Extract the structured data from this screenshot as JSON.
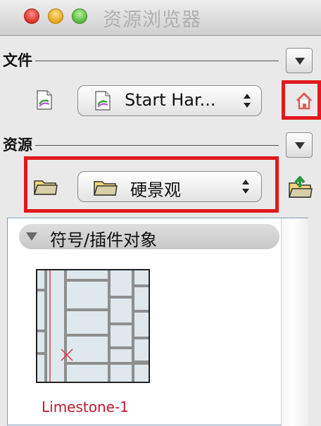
{
  "window": {
    "title": "资源浏览器"
  },
  "file_section": {
    "label": "文件",
    "popup_value": "Start Har...",
    "dropdown_icon": "triangle-down",
    "home_icon": "house-icon"
  },
  "resource_section": {
    "label": "资源",
    "popup_value": "硬景观",
    "dropdown_icon": "triangle-down",
    "import_icon": "folder-up-arrow-icon"
  },
  "content": {
    "group_label": "符号/插件对象",
    "items": [
      {
        "label": "Limestone-1",
        "icon": "symbol-thumbnail"
      }
    ]
  },
  "colors": {
    "highlight_border": "#e0191c",
    "item_label": "#c0182e"
  }
}
